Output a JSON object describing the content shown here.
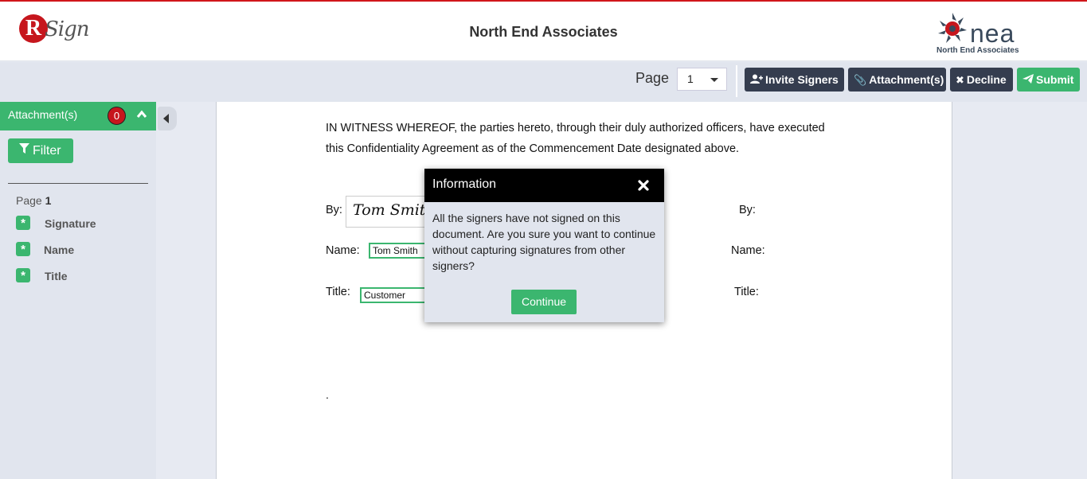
{
  "header": {
    "logo_left": {
      "r": "R",
      "sign": "Sign"
    },
    "company_title": "North End Associates",
    "logo_right": {
      "nea": "nea",
      "subtitle": "North End Associates"
    }
  },
  "toolbar": {
    "page_label": "Page",
    "page_value": "1",
    "buttons": {
      "invite": "Invite Signers",
      "attachments": "Attachment(s)",
      "decline": "Decline",
      "submit": "Submit"
    }
  },
  "sidebar": {
    "attach_label": "Attachment(s)",
    "attach_count": "0",
    "filter_label": "Filter",
    "page_text": "Page",
    "page_num": "1",
    "items": [
      {
        "label": "Signature"
      },
      {
        "label": "Name"
      },
      {
        "label": "Title"
      }
    ]
  },
  "document": {
    "paragraph": "IN WITNESS WHEREOF, the parties hereto, through their duly authorized officers, have executed this Confidentiality Agreement as of the Commencement Date designated above.",
    "left": {
      "by": "By:",
      "name": "Name:",
      "title": "Title:"
    },
    "right": {
      "by": "By:",
      "name": "Name:",
      "title": "Title:"
    },
    "signature_value": "Tom Smith",
    "name_value": "Tom Smith",
    "title_value": "Customer",
    "trailing": "."
  },
  "modal": {
    "title": "Information",
    "message": "All the signers have not signed on this document. Are you sure you want to continue without capturing signatures from other signers?",
    "continue_label": "Continue"
  },
  "colors": {
    "accent_green": "#3bb66f",
    "dark_button": "#353d4f",
    "badge_red": "#c6161d",
    "top_border": "#d0161a"
  }
}
